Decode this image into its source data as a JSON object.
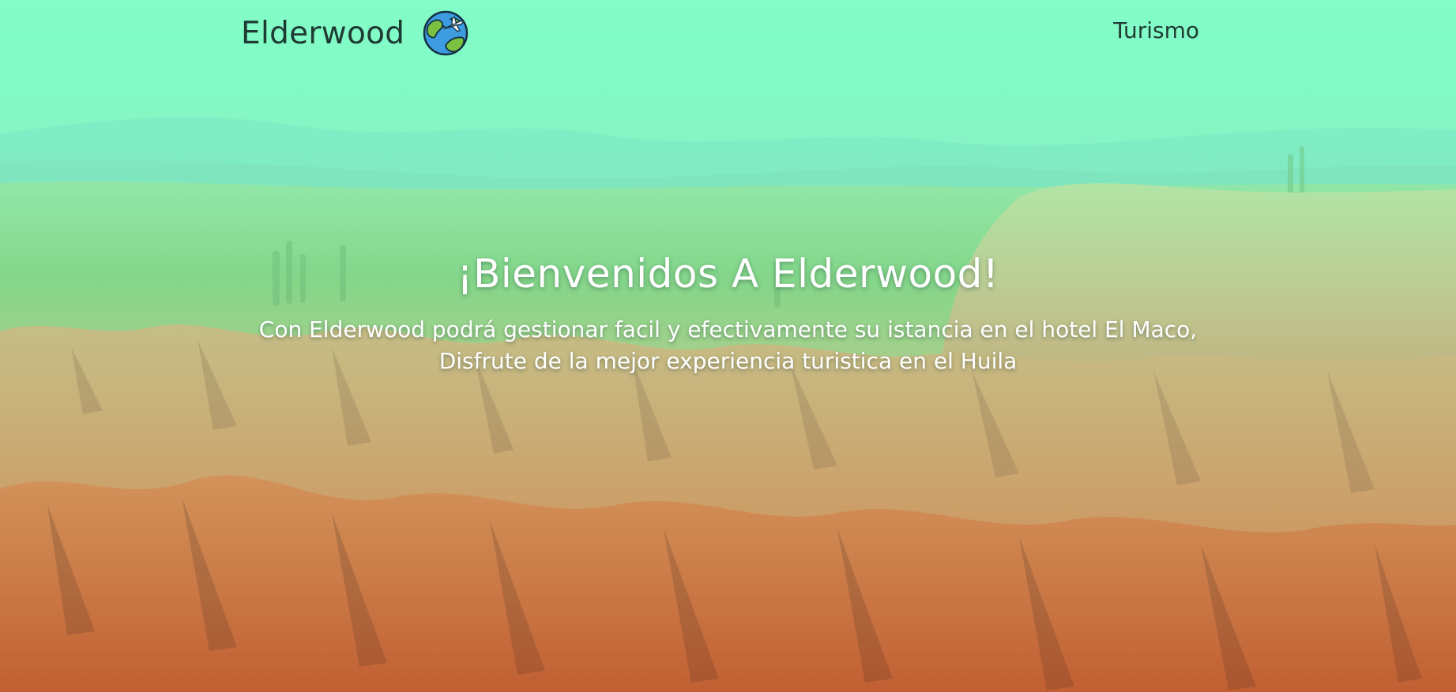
{
  "navbar": {
    "brand": "Elderwood",
    "brand_icon": "globe-airplane-icon",
    "links": [
      {
        "label": "Turismo"
      }
    ]
  },
  "hero": {
    "title": "¡Bienvenidos A Elderwood!",
    "subtitle": "Con Elderwood podrá gestionar facil y efectivamente su istancia en el hotel El Maco, Disfrute de la mejor experiencia turistica en el Huila",
    "background": "desert-landscape-photo"
  },
  "colors": {
    "overlay_top": "#86f9c4",
    "brand_text": "#1f3a33",
    "hero_text": "#ffffff",
    "earth_orange": "#d9733a"
  }
}
